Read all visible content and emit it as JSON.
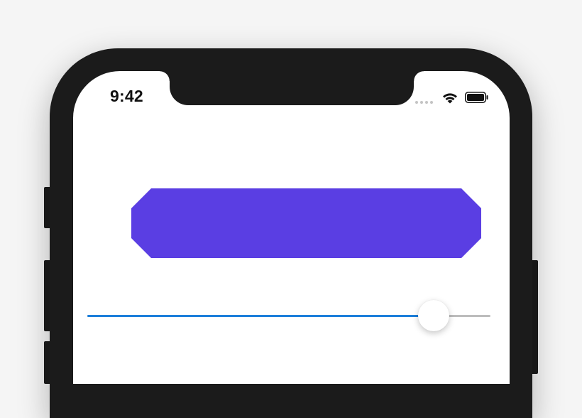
{
  "status_bar": {
    "time": "9:42",
    "wifi_icon": "wifi-icon",
    "battery_icon": "battery-icon",
    "signal_icon": "cellular-signal-dots"
  },
  "banner": {
    "shape": "octagon",
    "color": "#5a3ee3"
  },
  "slider": {
    "value_fraction": 0.86,
    "fill_color": "#1d7fdb",
    "track_color": "#bdbdbd"
  },
  "colors": {
    "frame": "#1b1b1b",
    "screen": "#ffffff",
    "background": "#f5f5f5"
  }
}
